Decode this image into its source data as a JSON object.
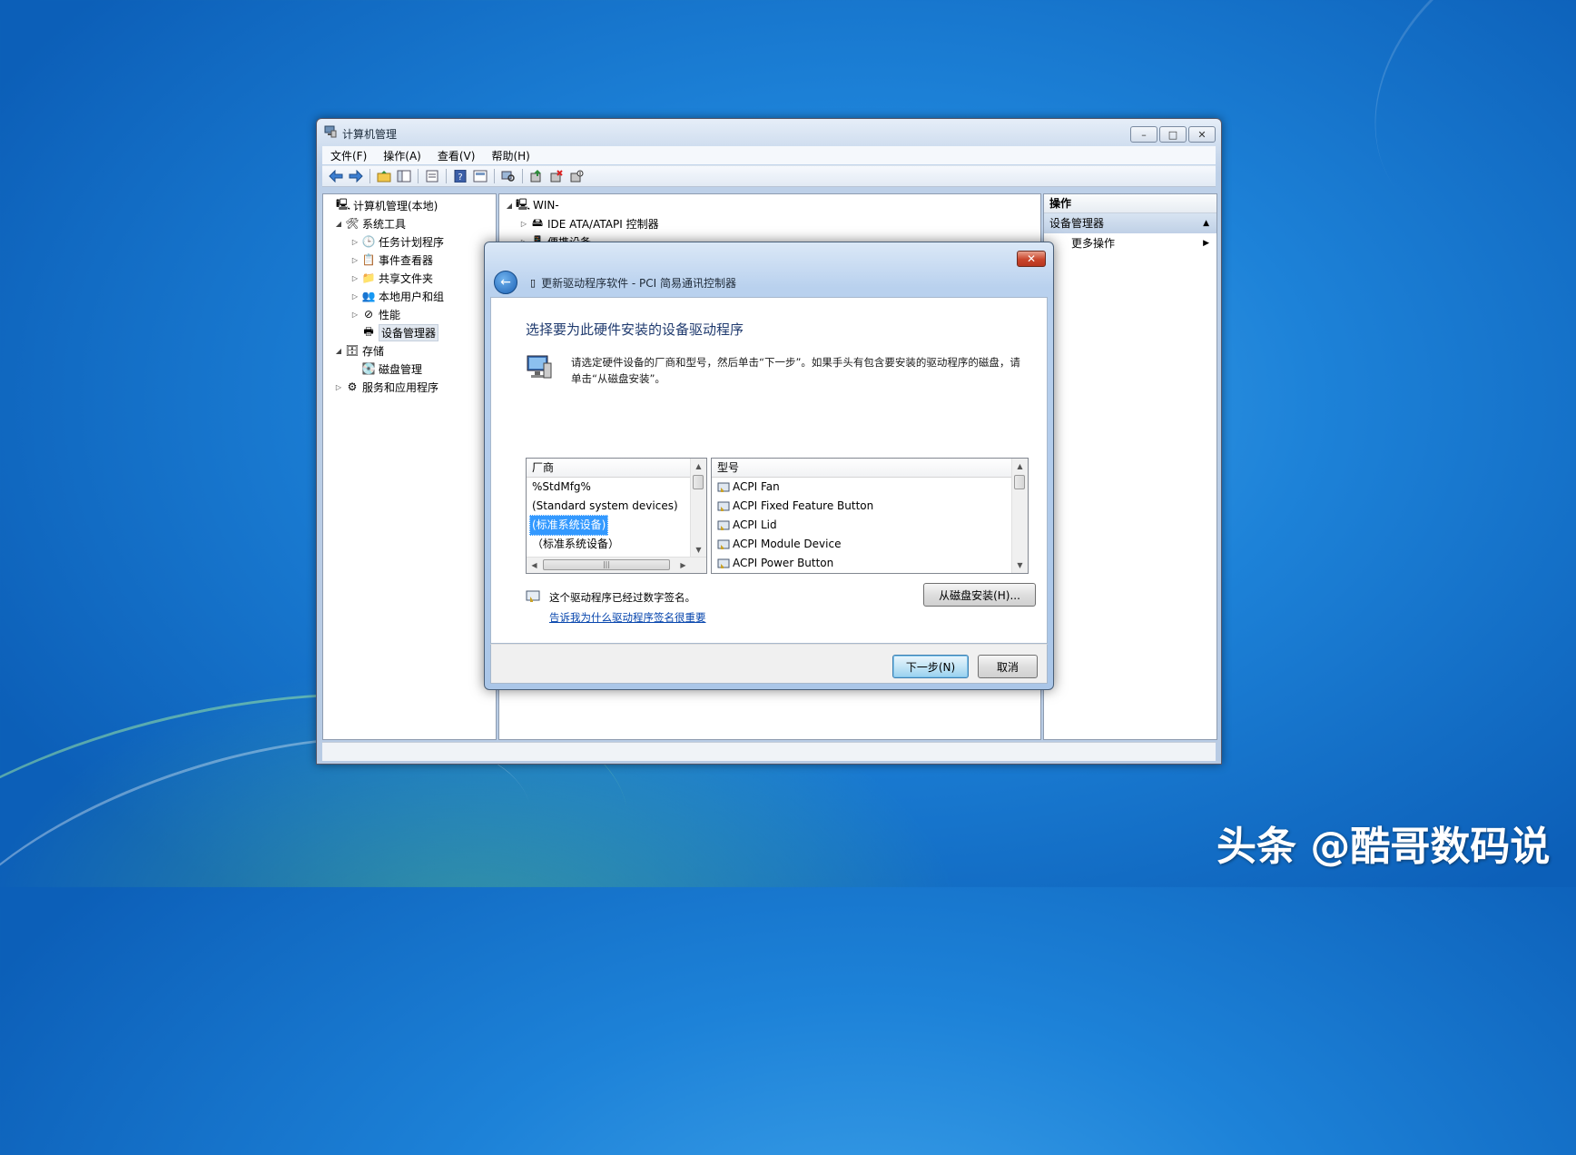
{
  "main_window": {
    "title": "计算机管理",
    "caption_buttons": {
      "minimize": "–",
      "maximize": "□",
      "close": "✕"
    },
    "menu": [
      "文件(F)",
      "操作(A)",
      "查看(V)",
      "帮助(H)"
    ],
    "toolbar_icons": [
      "back-arrow-icon",
      "forward-arrow-icon",
      "up-folder-icon",
      "show-tree-icon",
      "properties-icon",
      "help-icon",
      "console-icon",
      "scan-hardware-icon",
      "update-driver-icon",
      "uninstall-icon",
      "disable-icon"
    ],
    "tree": {
      "root": "计算机管理(本地)",
      "system_tools": "系统工具",
      "task_scheduler": "任务计划程序",
      "event_viewer": "事件查看器",
      "shared_folders": "共享文件夹",
      "local_users": "本地用户和组",
      "performance": "性能",
      "device_manager": "设备管理器",
      "storage": "存储",
      "disk_management": "磁盘管理",
      "services_apps": "服务和应用程序"
    },
    "devices": {
      "computer": "WIN-",
      "ide": "IDE ATA/ATAPI 控制器",
      "portable": "便携设备"
    },
    "actions": {
      "header": "操作",
      "section": "设备管理器",
      "more": "更多操作"
    }
  },
  "dialog": {
    "close": "✕",
    "wizard_title": "更新驱动程序软件 - PCI 简易通讯控制器",
    "heading": "选择要为此硬件安装的设备驱动程序",
    "instruction": "请选定硬件设备的厂商和型号，然后单击“下一步”。如果手头有包含要安装的驱动程序的磁盘，请单击“从磁盘安装”。",
    "vendor_header": "厂商",
    "vendors": [
      "%StdMfg%",
      "(Standard system devices)",
      "(标准系统设备)",
      "（标准系统设备）"
    ],
    "selected_vendor_index": 2,
    "model_header": "型号",
    "models": [
      "ACPI Fan",
      "ACPI Fixed Feature Button",
      "ACPI Lid",
      "ACPI Module Device",
      "ACPI Power Button"
    ],
    "signed_text": "这个驱动程序已经过数字签名。",
    "why_link": "告诉我为什么驱动程序签名很重要",
    "have_disk_button": "从磁盘安装(H)...",
    "next_button": "下一步(N)",
    "cancel_button": "取消"
  },
  "watermark": "头条 @酷哥数码说"
}
